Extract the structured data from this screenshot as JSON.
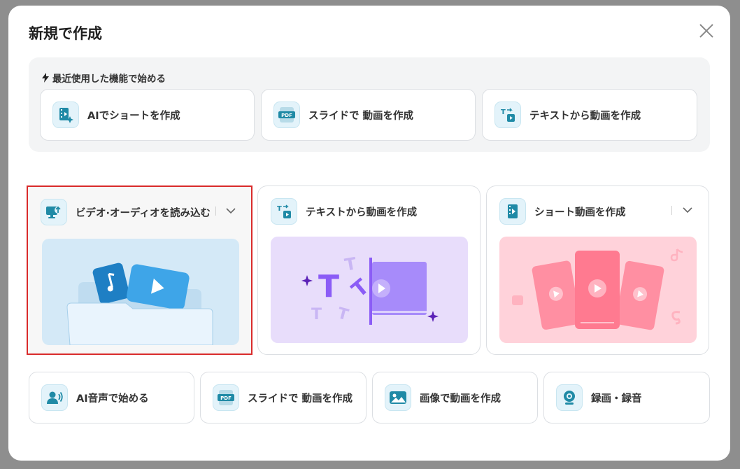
{
  "modal": {
    "title": "新規で作成"
  },
  "recent": {
    "header": "最近使用した機能で始める",
    "items": [
      {
        "label": "AIでショートを作成",
        "icon": "ai-short-video-icon"
      },
      {
        "label": "スライドで 動画を作成",
        "icon": "pdf-slide-icon"
      },
      {
        "label": "テキストから動画を作成",
        "icon": "text-to-video-icon"
      }
    ]
  },
  "main": {
    "cards": [
      {
        "label": "ビデオ·オーディオを読み込む",
        "icon": "import-media-icon",
        "selected": true
      },
      {
        "label": "テキストから動画を作成",
        "icon": "text-to-video-icon"
      },
      {
        "label": "ショート動画を作成",
        "icon": "short-video-icon"
      }
    ]
  },
  "bottom": {
    "items": [
      {
        "label": "AI音声で始める",
        "icon": "ai-voice-icon"
      },
      {
        "label": "スライドで 動画を作成",
        "icon": "pdf-slide-icon"
      },
      {
        "label": "画像で動画を作成",
        "icon": "image-icon"
      },
      {
        "label": "録画・録音",
        "icon": "webcam-icon"
      }
    ]
  },
  "colors": {
    "accent_teal": "#1f8aa6",
    "selected_border": "#d92b2b",
    "purple": "#8b5cf6",
    "pink": "#ff7a90"
  }
}
